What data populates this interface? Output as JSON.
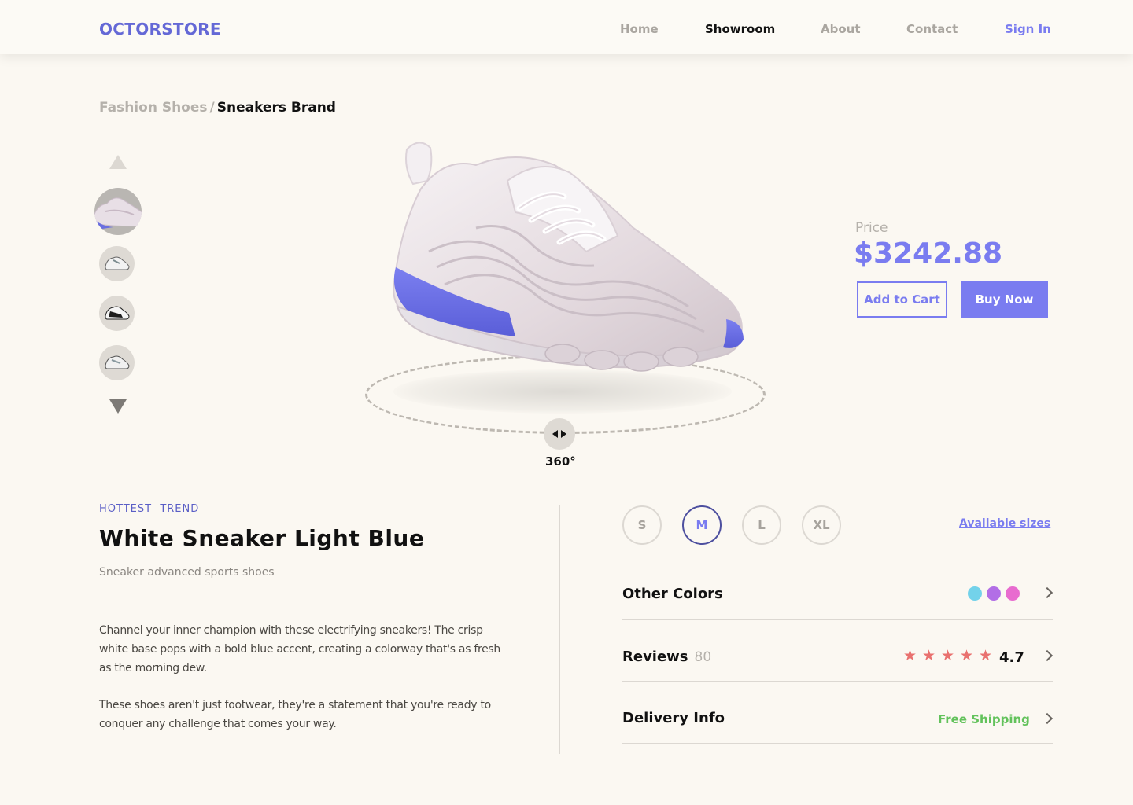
{
  "brand": "OCTORSTORE",
  "nav": {
    "home": "Home",
    "showroom": "Showroom",
    "about": "About",
    "contact": "Contact",
    "signin": "Sign In"
  },
  "breadcrumb": {
    "parent": "Fashion Shoes",
    "separator": "/",
    "current": "Sneakers Brand"
  },
  "viewer": {
    "rotate_label": "360°",
    "accent_color": "#6a6ee0"
  },
  "price": {
    "label": "Price",
    "value": "$3242.88"
  },
  "actions": {
    "add_to_cart": "Add to Cart",
    "buy_now": "Buy Now"
  },
  "product": {
    "tagline": "HOTTEST  TREND",
    "title": "White Sneaker Light Blue",
    "subtitle": "Sneaker advanced sports shoes",
    "description_1": "Channel your inner champion with these electrifying sneakers! The crisp white base pops with a bold blue accent, creating a colorway that's as fresh as the morning dew.",
    "description_2": "These shoes aren't just footwear, they're a statement that you're ready to conquer any challenge that comes your way."
  },
  "sizes": {
    "options": [
      "S",
      "M",
      "L",
      "XL"
    ],
    "selected": "M",
    "link": "Available sizes"
  },
  "colors_row": {
    "title": "Other Colors",
    "swatches": [
      "#73d2ea",
      "#b26ee6",
      "#e86bcf"
    ]
  },
  "reviews_row": {
    "title": "Reviews",
    "count": "80",
    "stars": 5,
    "star_color": "#e9716f",
    "rating": "4.7"
  },
  "delivery_row": {
    "title": "Delivery Info",
    "status": "Free Shipping",
    "status_color": "#62c25b"
  }
}
